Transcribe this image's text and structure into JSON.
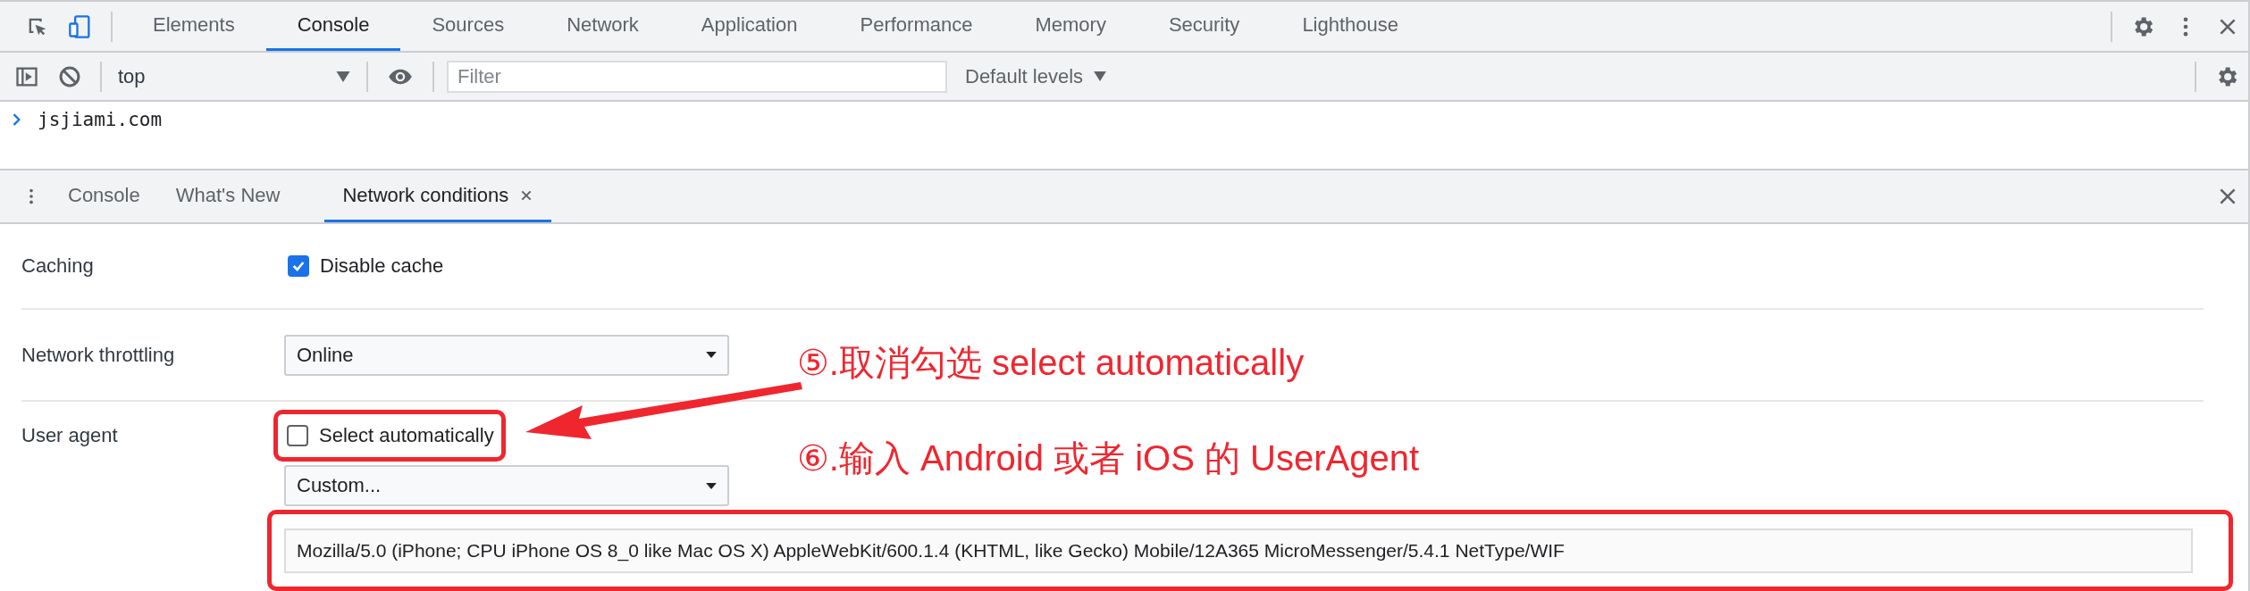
{
  "main_tabs": [
    {
      "label": "Elements",
      "selected": false
    },
    {
      "label": "Console",
      "selected": true
    },
    {
      "label": "Sources",
      "selected": false
    },
    {
      "label": "Network",
      "selected": false
    },
    {
      "label": "Application",
      "selected": false
    },
    {
      "label": "Performance",
      "selected": false
    },
    {
      "label": "Memory",
      "selected": false
    },
    {
      "label": "Security",
      "selected": false
    },
    {
      "label": "Lighthouse",
      "selected": false
    }
  ],
  "toolbar": {
    "context": "top",
    "filter": {
      "placeholder": "Filter"
    },
    "levels": "Default levels"
  },
  "console": {
    "lines": [
      "jsjiami.com"
    ]
  },
  "drawer_tabs": [
    {
      "label": "Console",
      "selected": false,
      "closable": false
    },
    {
      "label": "What's New",
      "selected": false,
      "closable": false
    },
    {
      "label": "Network conditions",
      "selected": true,
      "closable": true
    }
  ],
  "rows": [
    {
      "kind": "checkbox",
      "label": "Caching",
      "option": "Disable cache",
      "checked": true
    },
    {
      "kind": "select",
      "label": "Network throttling",
      "value": "Online"
    },
    {
      "kind": "user_agent",
      "label": "User agent",
      "option": "Select automatically",
      "checked": false,
      "preset": "Custom...",
      "value": "Mozilla/5.0 (iPhone; CPU iPhone OS 8_0 like Mac OS X) AppleWebKit/600.1.4 (KHTML, like Gecko) Mobile/12A365 MicroMessenger/5.4.1 NetType/WIF"
    }
  ],
  "annotations": [
    {
      "text": "⑤.取消勾选 select automatically"
    },
    {
      "text": "⑥.输入 Android 或者 iOS 的 UserAgent"
    }
  ]
}
